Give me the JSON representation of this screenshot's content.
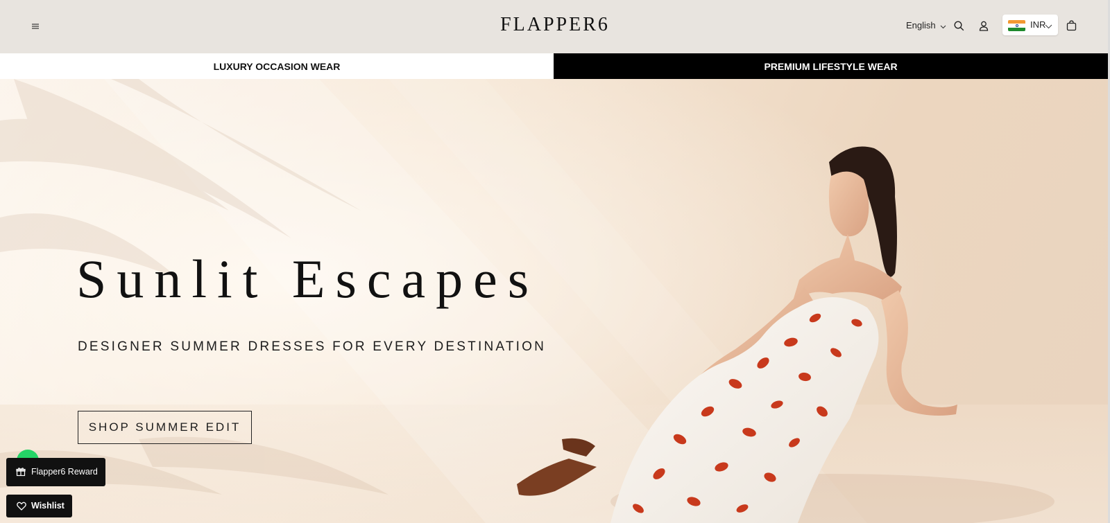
{
  "header": {
    "logo": "FLAPPER6",
    "language": "English",
    "currency": "INR",
    "icons": [
      "menu-icon",
      "chevron-down-icon",
      "search-icon",
      "account-icon",
      "india-flag-icon",
      "cart-icon"
    ]
  },
  "tabs": [
    {
      "label": "LUXURY OCCASION WEAR",
      "active": false
    },
    {
      "label": "PREMIUM LIFESTYLE WEAR",
      "active": true
    }
  ],
  "hero": {
    "title": "Sunlit Escapes",
    "subtitle": "DESIGNER SUMMER DRESSES FOR EVERY DESTINATION",
    "cta": "SHOP SUMMER EDIT"
  },
  "floating": {
    "reward_label": "Flapper6 Reward",
    "wishlist_label": "Wishlist",
    "icons": [
      "whatsapp-icon",
      "gift-icon",
      "heart-icon"
    ]
  },
  "colors": {
    "header_bg": "#e8e4df",
    "active_tab_bg": "#000000",
    "hero_bg": "#f3e3d1",
    "button_dark": "#111111",
    "whatsapp_green": "#25d366",
    "dress_print": "#c8391c"
  }
}
